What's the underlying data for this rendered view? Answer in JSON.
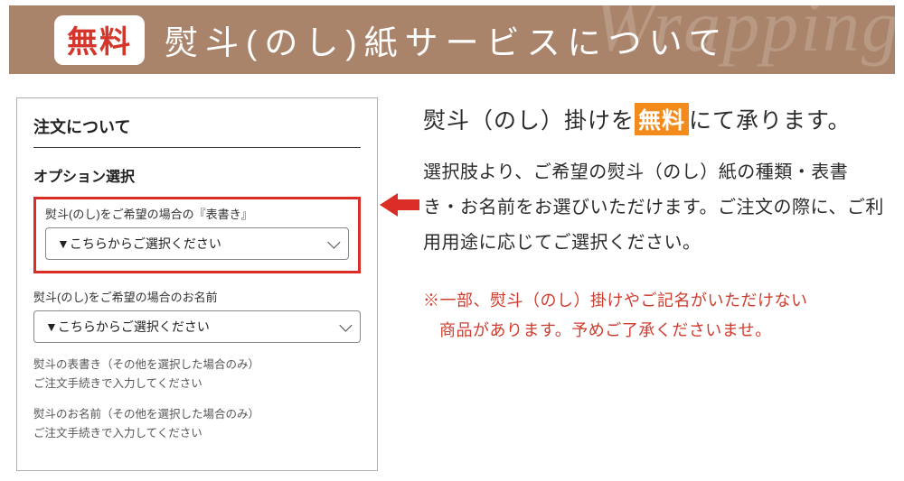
{
  "banner": {
    "badge": "無料",
    "title": "熨斗(のし)紙サービスについて",
    "script_bg": "Wrapping"
  },
  "panel": {
    "title": "注文について",
    "option_title": "オプション選択",
    "field1": {
      "label": "熨斗(のし)をご希望の場合の『表書き』",
      "select_text": "▼こちらからご選択ください"
    },
    "field2": {
      "label": "熨斗(のし)をご希望の場合のお名前",
      "select_text": "▼こちらからご選択ください"
    },
    "hint1_line1": "熨斗の表書き（その他を選択した場合のみ）",
    "hint1_line2": "ご注文手続きで入力してください",
    "hint2_line1": "熨斗のお名前（その他を選択した場合のみ）",
    "hint2_line2": "ご注文手続きで入力してください"
  },
  "right": {
    "lead_pre": "熨斗（のし）掛けを",
    "lead_free": "無料",
    "lead_post": "にて承ります。",
    "body": "選択肢より、ご希望の熨斗（のし）紙の種類・表書き・お名前をお選びいただけます。ご注文の際に、ご利用用途に応じてご選択ください。",
    "note_line1": "※一部、熨斗（のし）掛けやご記名がいただけない",
    "note_line2": "商品があります。予めご了承くださいませ。"
  }
}
